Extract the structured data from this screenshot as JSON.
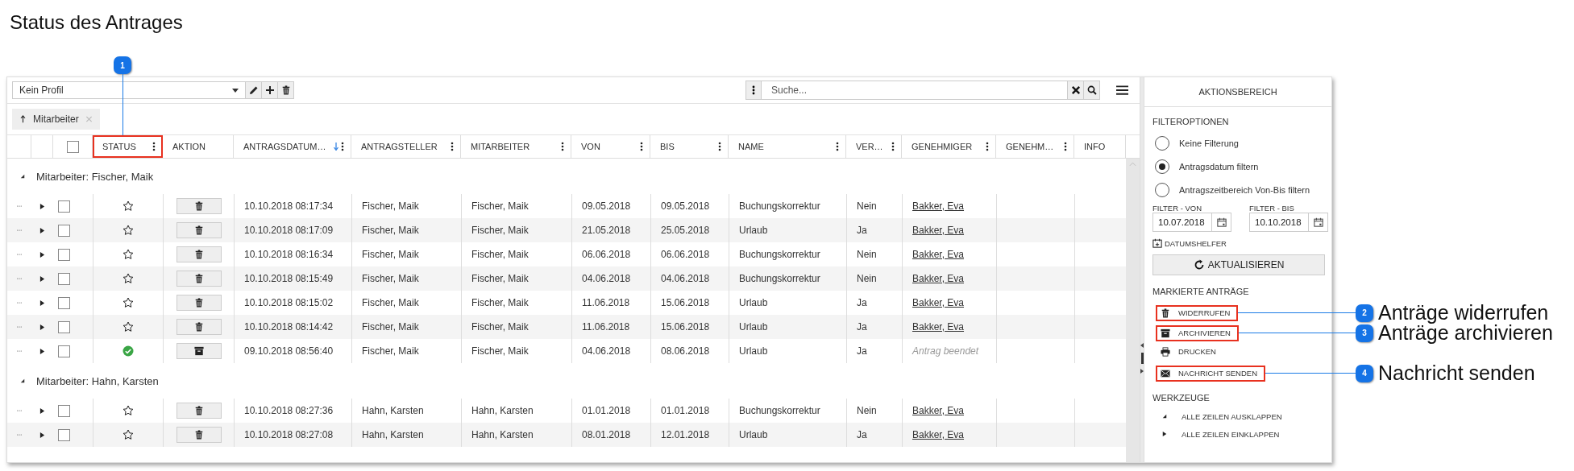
{
  "title": "Status des Antrages",
  "toolbar": {
    "profile": "Kein Profil",
    "search_placeholder": "Suche..."
  },
  "group_chip": {
    "label": "Mitarbeiter"
  },
  "select_all_checked": false,
  "columns": [
    {
      "label": "STATUS",
      "menu": true,
      "callout": "1"
    },
    {
      "label": "AKTION",
      "menu": false
    },
    {
      "label": "ANTRAGSDATUM…",
      "menu": true,
      "sorted": true
    },
    {
      "label": "ANTRAGSTELLER",
      "menu": true
    },
    {
      "label": "MITARBEITER",
      "menu": true
    },
    {
      "label": "VON",
      "menu": true
    },
    {
      "label": "BIS",
      "menu": true
    },
    {
      "label": "NAME",
      "menu": true
    },
    {
      "label": "VER…",
      "menu": true
    },
    {
      "label": "GENEHMIGER",
      "menu": true
    },
    {
      "label": "GENEHM…",
      "menu": true
    },
    {
      "label": "INFO",
      "menu": false
    }
  ],
  "groups": [
    {
      "label": "Mitarbeiter: Fischer, Maik",
      "expanded": true,
      "rows": [
        {
          "checked": false,
          "expanded": false,
          "status": {
            "kind": "star"
          },
          "action": {
            "kind": "delete"
          },
          "cells": [
            "10.10.2018 08:17:34",
            "Fischer, Maik",
            "Fischer, Maik",
            "09.05.2018",
            "09.05.2018",
            "Buchungskorrektur",
            "Nein"
          ],
          "approver": {
            "kind": "link",
            "text": "Bakker, Eva"
          }
        },
        {
          "checked": false,
          "expanded": false,
          "status": {
            "kind": "star"
          },
          "action": {
            "kind": "delete"
          },
          "cells": [
            "10.10.2018 08:17:09",
            "Fischer, Maik",
            "Fischer, Maik",
            "21.05.2018",
            "25.05.2018",
            "Urlaub",
            "Ja"
          ],
          "approver": {
            "kind": "link",
            "text": "Bakker, Eva"
          }
        },
        {
          "checked": false,
          "expanded": false,
          "status": {
            "kind": "star"
          },
          "action": {
            "kind": "delete"
          },
          "cells": [
            "10.10.2018 08:16:34",
            "Fischer, Maik",
            "Fischer, Maik",
            "06.06.2018",
            "06.06.2018",
            "Buchungskorrektur",
            "Nein"
          ],
          "approver": {
            "kind": "link",
            "text": "Bakker, Eva"
          }
        },
        {
          "checked": false,
          "expanded": false,
          "status": {
            "kind": "star"
          },
          "action": {
            "kind": "delete"
          },
          "cells": [
            "10.10.2018 08:15:49",
            "Fischer, Maik",
            "Fischer, Maik",
            "04.06.2018",
            "04.06.2018",
            "Buchungskorrektur",
            "Nein"
          ],
          "approver": {
            "kind": "link",
            "text": "Bakker, Eva"
          }
        },
        {
          "checked": false,
          "expanded": false,
          "status": {
            "kind": "star"
          },
          "action": {
            "kind": "delete"
          },
          "cells": [
            "10.10.2018 08:15:02",
            "Fischer, Maik",
            "Fischer, Maik",
            "11.06.2018",
            "15.06.2018",
            "Urlaub",
            "Ja"
          ],
          "approver": {
            "kind": "link",
            "text": "Bakker, Eva"
          }
        },
        {
          "checked": false,
          "expanded": false,
          "status": {
            "kind": "star"
          },
          "action": {
            "kind": "delete"
          },
          "cells": [
            "10.10.2018 08:14:42",
            "Fischer, Maik",
            "Fischer, Maik",
            "11.06.2018",
            "15.06.2018",
            "Urlaub",
            "Ja"
          ],
          "approver": {
            "kind": "link",
            "text": "Bakker, Eva"
          }
        },
        {
          "checked": false,
          "expanded": false,
          "status": {
            "kind": "done"
          },
          "action": {
            "kind": "archive"
          },
          "cells": [
            "09.10.2018 08:56:40",
            "Fischer, Maik",
            "Fischer, Maik",
            "04.06.2018",
            "08.06.2018",
            "Urlaub",
            "Ja"
          ],
          "approver": {
            "kind": "note",
            "text": "Antrag beendet"
          }
        }
      ]
    },
    {
      "label": "Mitarbeiter: Hahn, Karsten",
      "expanded": true,
      "rows": [
        {
          "checked": false,
          "expanded": false,
          "status": {
            "kind": "star"
          },
          "action": {
            "kind": "delete"
          },
          "cells": [
            "10.10.2018 08:27:36",
            "Hahn, Karsten",
            "Hahn, Karsten",
            "01.01.2018",
            "01.01.2018",
            "Buchungskorrektur",
            "Nein"
          ],
          "approver": {
            "kind": "link",
            "text": "Bakker, Eva"
          }
        },
        {
          "checked": false,
          "expanded": false,
          "status": {
            "kind": "star"
          },
          "action": {
            "kind": "delete"
          },
          "cells": [
            "10.10.2018 08:27:08",
            "Hahn, Karsten",
            "Hahn, Karsten",
            "08.01.2018",
            "12.01.2018",
            "Urlaub",
            "Ja"
          ],
          "approver": {
            "kind": "link",
            "text": "Bakker, Eva"
          }
        }
      ]
    }
  ],
  "panel": {
    "title": "AKTIONSBEREICH",
    "filter_heading": "FILTEROPTIONEN",
    "filters": [
      {
        "label": "Keine Filterung",
        "selected": false
      },
      {
        "label": "Antragsdatum filtern",
        "selected": true
      },
      {
        "label": "Antragszeitbereich Von-Bis filtern",
        "selected": false
      }
    ],
    "dates": [
      {
        "label": "FILTER - VON",
        "value": "10.07.2018"
      },
      {
        "label": "FILTER - BIS",
        "value": "10.10.2018"
      }
    ],
    "date_helper": "DATUMSHELFER",
    "refresh": "AKTUALISIEREN",
    "marked_heading": "MARKIERTE ANTRÄGE",
    "actions": [
      {
        "kind": "trash",
        "label": "WIDERRUFEN",
        "callout": {
          "number": "2",
          "label": "Anträge widerrufen"
        }
      },
      {
        "kind": "archive",
        "label": "ARCHIVIEREN",
        "callout": {
          "number": "3",
          "label": "Anträge archivieren"
        }
      },
      {
        "kind": "print",
        "label": "DRUCKEN"
      },
      {
        "kind": "mail",
        "label": "NACHRICHT SENDEN",
        "callout": {
          "number": "4",
          "label": "Nachricht senden"
        }
      }
    ],
    "tools_heading": "WERKZEUGE",
    "tools": [
      {
        "kind": "expand",
        "label": "ALLE ZEILEN AUSKLAPPEN"
      },
      {
        "kind": "collapse",
        "label": "ALLE ZEILEN EINKLAPPEN"
      }
    ]
  }
}
